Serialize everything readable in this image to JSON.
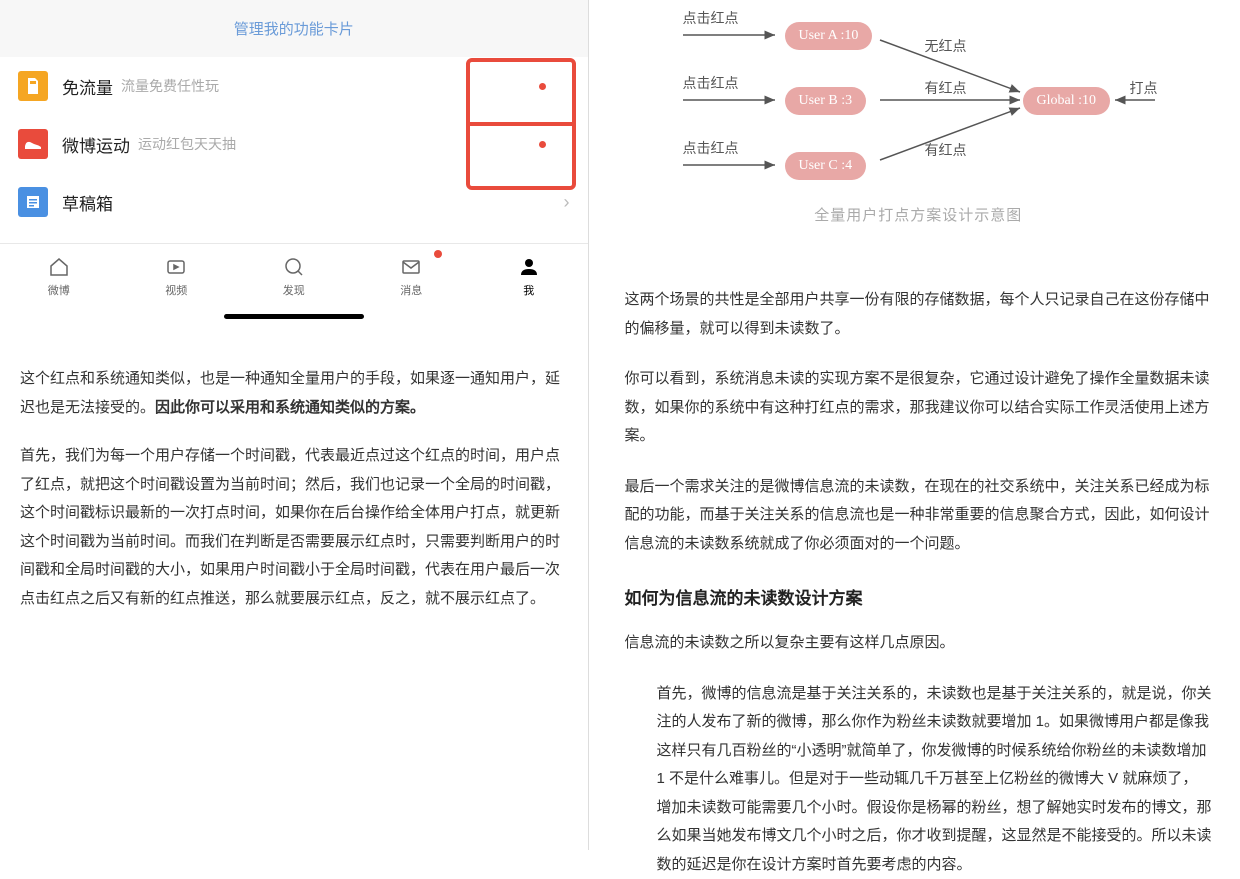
{
  "left": {
    "phoneHeader": "管理我的功能卡片",
    "items": [
      {
        "title": "免流量",
        "sub": "流量免费任性玩",
        "iconBg": "#f5a623"
      },
      {
        "title": "微博运动",
        "sub": "运动红包天天抽",
        "iconBg": "#e94b3c"
      },
      {
        "title": "草稿箱",
        "sub": "",
        "iconBg": "#4a90e2",
        "chevron": "›"
      }
    ],
    "tabs": [
      {
        "label": "微博"
      },
      {
        "label": "视频"
      },
      {
        "label": "发现"
      },
      {
        "label": "消息"
      },
      {
        "label": "我"
      }
    ],
    "p1a": "这个红点和系统通知类似，也是一种通知全量用户的手段，如果逐一通知用户，延迟也是无法接受的。",
    "p1b": "因此你可以采用和系统通知类似的方案。",
    "p2": "首先，我们为每一个用户存储一个时间戳，代表最近点过这个红点的时间，用户点了红点，就把这个时间戳设置为当前时间；然后，我们也记录一个全局的时间戳，这个时间戳标识最新的一次打点时间，如果你在后台操作给全体用户打点，就更新这个时间戳为当前时间。而我们在判断是否需要展示红点时，只需要判断用户的时间戳和全局时间戳的大小，如果用户时间戳小于全局时间戳，代表在用户最后一次点击红点之后又有新的红点推送，那么就要展示红点，反之，就不展示红点了。"
  },
  "right": {
    "diagram": {
      "click": "点击红点",
      "nodeA": "User A :10",
      "nodeB": "User B :3",
      "nodeC": "User C :4",
      "nodeG": "Global :10",
      "noRed": "无红点",
      "hasRed": "有红点",
      "hit": "打点",
      "caption": "全量用户打点方案设计示意图"
    },
    "p1": "这两个场景的共性是全部用户共享一份有限的存储数据，每个人只记录自己在这份存储中的偏移量，就可以得到未读数了。",
    "p2": "你可以看到，系统消息未读的实现方案不是很复杂，它通过设计避免了操作全量数据未读数，如果你的系统中有这种打红点的需求，那我建议你可以结合实际工作灵活使用上述方案。",
    "p3": "最后一个需求关注的是微博信息流的未读数，在现在的社交系统中，关注关系已经成为标配的功能，而基于关注关系的信息流也是一种非常重要的信息聚合方式，因此，如何设计信息流的未读数系统就成了你必须面对的一个问题。",
    "h1": "如何为信息流的未读数设计方案",
    "p4": "信息流的未读数之所以复杂主要有这样几点原因。",
    "p5": "首先，微博的信息流是基于关注关系的，未读数也是基于关注关系的，就是说，你关注的人发布了新的微博，那么你作为粉丝未读数就要增加 1。如果微博用户都是像我这样只有几百粉丝的“小透明”就简单了，你发微博的时候系统给你粉丝的未读数增加 1 不是什么难事儿。但是对于一些动辄几千万甚至上亿粉丝的微博大 V 就麻烦了，增加未读数可能需要几个小时。假设你是杨幂的粉丝，想了解她实时发布的博文，那么如果当她发布博文几个小时之后，你才收到提醒，这显然是不能接受的。所以未读数的延迟是你在设计方案时首先要考虑的内容。"
  }
}
